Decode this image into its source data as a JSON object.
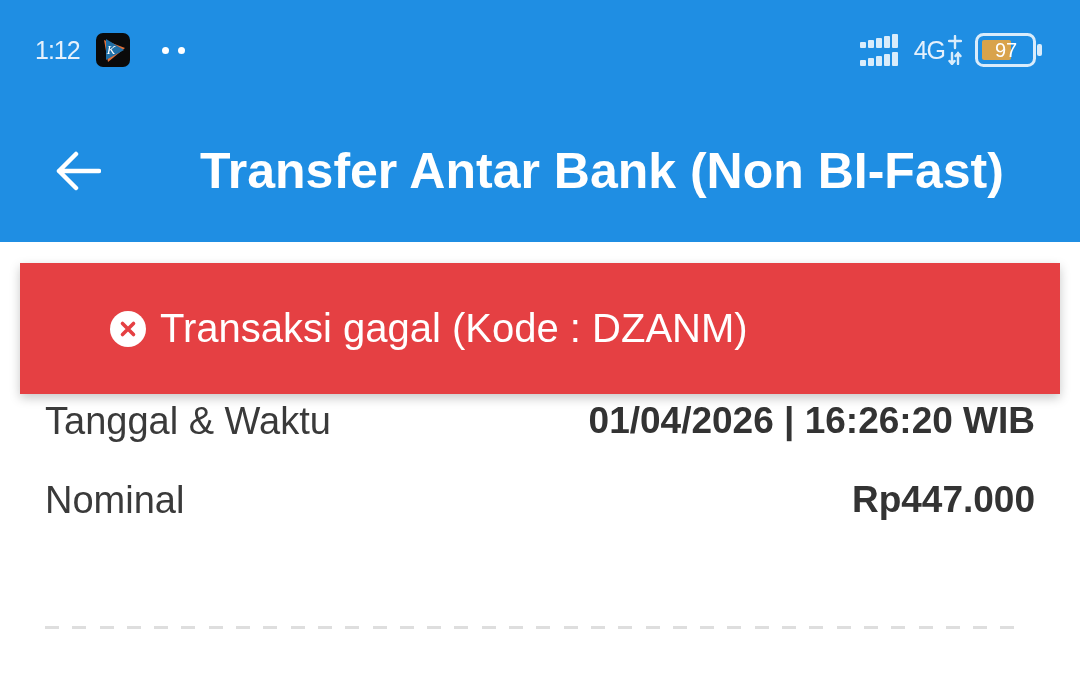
{
  "status_bar": {
    "time": "1:12",
    "app_icon_letter": "K",
    "network": "4G",
    "battery": "97"
  },
  "app_bar": {
    "title": "Transfer Antar Bank (Non BI-Fast)"
  },
  "alert": {
    "kind": "error",
    "message": "Transaksi gagal (Kode : DZANM)"
  },
  "details": [
    {
      "label": "Tanggal & Waktu",
      "value": "01/04/2026 | 16:26:20 WIB"
    },
    {
      "label": "Nominal",
      "value": "Rp447.000"
    }
  ]
}
